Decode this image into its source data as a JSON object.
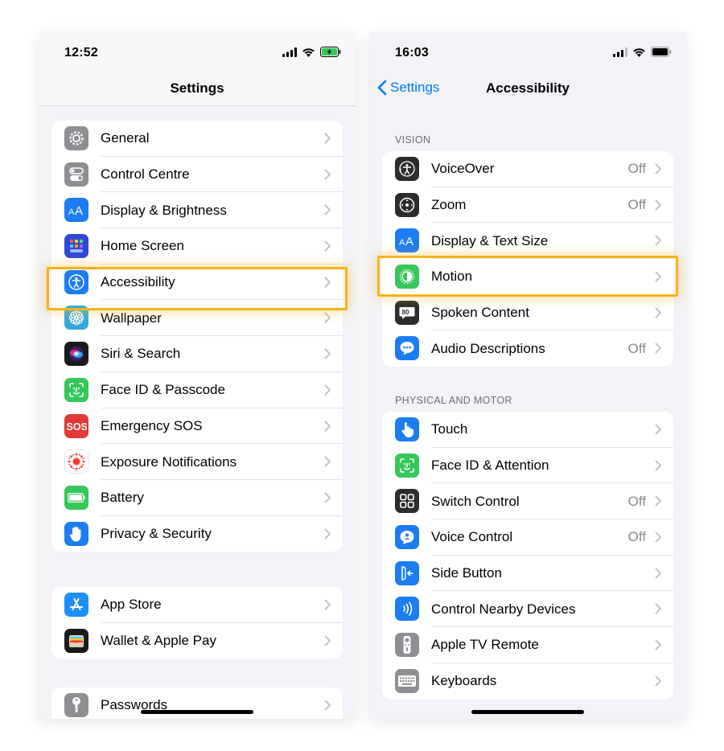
{
  "left": {
    "status": {
      "time": "12:52"
    },
    "nav": {
      "title": "Settings"
    },
    "groups": [
      [
        {
          "label": "General",
          "icon": "gear-icon",
          "color": "#8e8e93"
        },
        {
          "label": "Control Centre",
          "icon": "toggles-icon",
          "color": "#8e8e93"
        },
        {
          "label": "Display & Brightness",
          "icon": "text-size-icon",
          "color": "#1c7cf2"
        },
        {
          "label": "Home Screen",
          "icon": "home-grid-icon",
          "color": "#2f49d6"
        },
        {
          "label": "Accessibility",
          "icon": "accessibility-icon",
          "color": "#1c7cf2"
        },
        {
          "label": "Wallpaper",
          "icon": "flower-icon",
          "color": "#34aadc"
        },
        {
          "label": "Siri & Search",
          "icon": "siri-icon",
          "color": "#1a1a1a"
        },
        {
          "label": "Face ID & Passcode",
          "icon": "face-id-icon",
          "color": "#34c759"
        },
        {
          "label": "Emergency SOS",
          "icon": "sos-icon",
          "color": "#e53935"
        },
        {
          "label": "Exposure Notifications",
          "icon": "exposure-icon",
          "color": "#ffffff"
        },
        {
          "label": "Battery",
          "icon": "battery-icon",
          "color": "#34c759"
        },
        {
          "label": "Privacy & Security",
          "icon": "hand-icon",
          "color": "#1c7cf2"
        }
      ],
      [
        {
          "label": "App Store",
          "icon": "app-store-icon",
          "color": "#1c8ef9"
        },
        {
          "label": "Wallet & Apple Pay",
          "icon": "wallet-icon",
          "color": "#1a1a1a"
        }
      ],
      [
        {
          "label": "Passwords",
          "icon": "key-icon",
          "color": "#8e8e93"
        }
      ]
    ]
  },
  "right": {
    "status": {
      "time": "16:03"
    },
    "nav": {
      "title": "Accessibility",
      "back_label": "Settings"
    },
    "sections": [
      {
        "header": "VISION",
        "rows": [
          {
            "label": "VoiceOver",
            "value": "Off",
            "icon": "voiceover-icon",
            "color": "#2c2c2e"
          },
          {
            "label": "Zoom",
            "value": "Off",
            "icon": "zoom-icon",
            "color": "#2c2c2e"
          },
          {
            "label": "Display & Text Size",
            "value": "",
            "icon": "text-size-icon",
            "color": "#1c7cf2"
          },
          {
            "label": "Motion",
            "value": "",
            "icon": "motion-icon",
            "color": "#34c759"
          },
          {
            "label": "Spoken Content",
            "value": "",
            "icon": "speech-bubble-icon",
            "color": "#2c2c2e"
          },
          {
            "label": "Audio Descriptions",
            "value": "Off",
            "icon": "audio-description-icon",
            "color": "#1c7cf2"
          }
        ]
      },
      {
        "header": "PHYSICAL AND MOTOR",
        "rows": [
          {
            "label": "Touch",
            "value": "",
            "icon": "touch-icon",
            "color": "#1c7cf2"
          },
          {
            "label": "Face ID & Attention",
            "value": "",
            "icon": "face-id-icon",
            "color": "#34c759"
          },
          {
            "label": "Switch Control",
            "value": "Off",
            "icon": "switch-grid-icon",
            "color": "#2c2c2e"
          },
          {
            "label": "Voice Control",
            "value": "Off",
            "icon": "voice-control-icon",
            "color": "#1c7cf2"
          },
          {
            "label": "Side Button",
            "value": "",
            "icon": "side-button-icon",
            "color": "#1c7cf2"
          },
          {
            "label": "Control Nearby Devices",
            "value": "",
            "icon": "nearby-devices-icon",
            "color": "#1c7cf2"
          },
          {
            "label": "Apple TV Remote",
            "value": "",
            "icon": "tv-remote-icon",
            "color": "#8e8e93"
          },
          {
            "label": "Keyboards",
            "value": "",
            "icon": "keyboard-icon",
            "color": "#8e8e93"
          }
        ]
      }
    ]
  },
  "highlight_color": "#f5b21c",
  "accent_color": "#007aff"
}
